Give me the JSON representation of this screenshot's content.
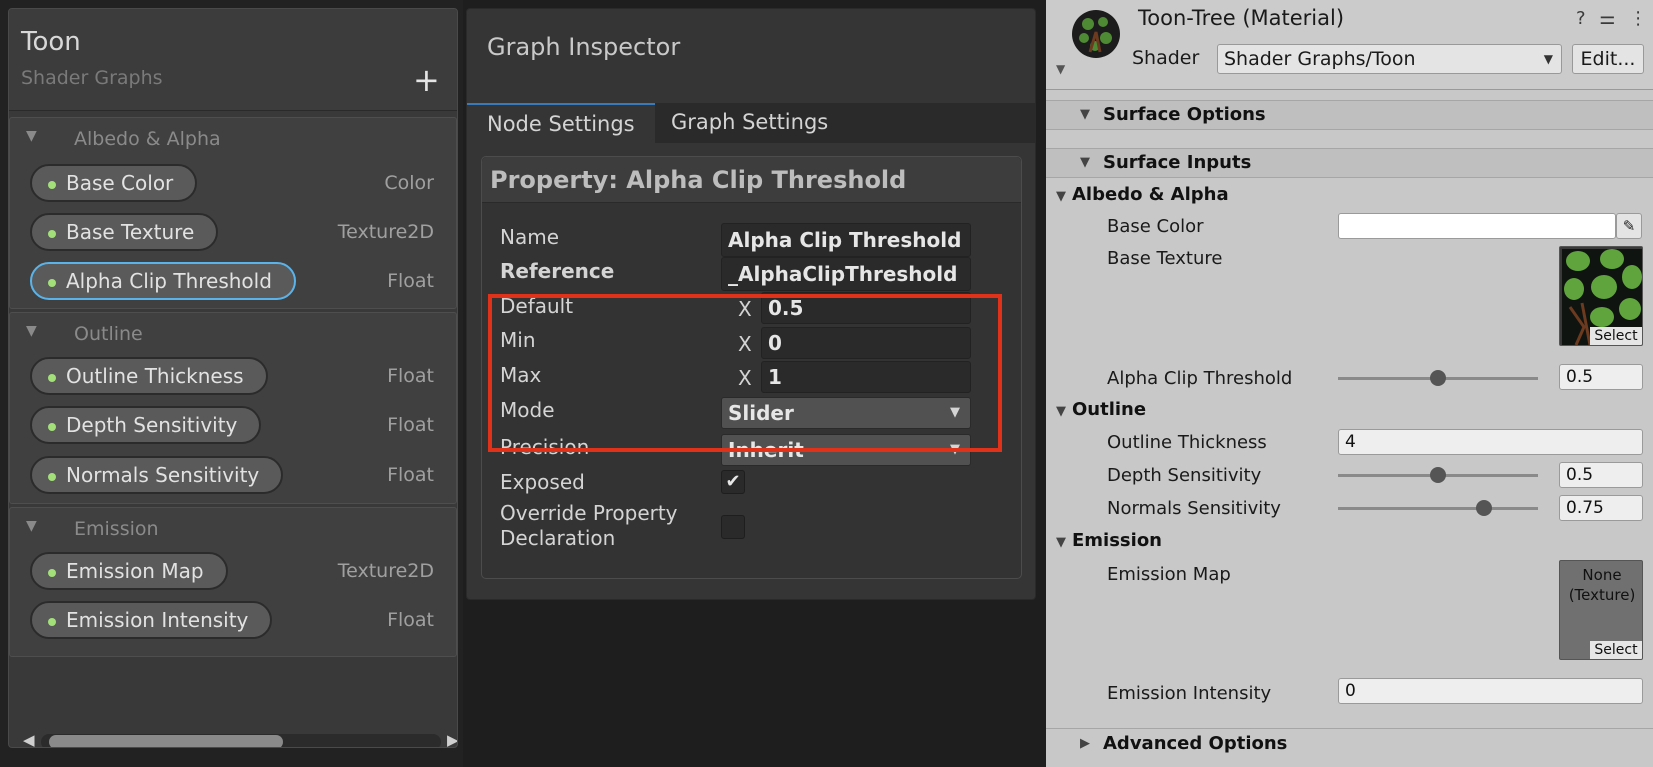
{
  "blackboard": {
    "title": "Toon",
    "subtitle": "Shader Graphs",
    "add_icon": "+",
    "categories": [
      {
        "name": "Albedo & Alpha",
        "properties": [
          {
            "label": "Base Color",
            "type": "Color"
          },
          {
            "label": "Base Texture",
            "type": "Texture2D"
          },
          {
            "label": "Alpha Clip Threshold",
            "type": "Float",
            "selected": true
          }
        ]
      },
      {
        "name": "Outline",
        "properties": [
          {
            "label": "Outline Thickness",
            "type": "Float"
          },
          {
            "label": "Depth Sensitivity",
            "type": "Float"
          },
          {
            "label": "Normals Sensitivity",
            "type": "Float"
          }
        ]
      },
      {
        "name": "Emission",
        "properties": [
          {
            "label": "Emission Map",
            "type": "Texture2D"
          },
          {
            "label": "Emission Intensity",
            "type": "Float"
          }
        ]
      }
    ],
    "scroll_left": "◀",
    "scroll_right": "▶"
  },
  "graph_inspector": {
    "title": "Graph Inspector",
    "tabs": [
      "Node Settings",
      "Graph Settings"
    ],
    "active_tab": "Node Settings",
    "property_title": "Property: Alpha Clip Threshold",
    "fields": {
      "name_label": "Name",
      "name_value": "Alpha Clip Threshold",
      "reference_label": "Reference",
      "reference_value": "_AlphaClipThreshold",
      "default_label": "Default",
      "default_value": "0.5",
      "min_label": "Min",
      "min_value": "0",
      "max_label": "Max",
      "max_value": "1",
      "axis_label": "X",
      "mode_label": "Mode",
      "mode_value": "Slider",
      "precision_label": "Precision",
      "precision_value": "Inherit",
      "exposed_label": "Exposed",
      "exposed_checked": true,
      "override_label_1": "Override Property",
      "override_label_2": "Declaration",
      "override_checked": false
    },
    "highlight_color": "#e0321a"
  },
  "material_inspector": {
    "name": "Toon-Tree (Material)",
    "header_icons": "? ⚌ ⋮",
    "shader_label": "Shader",
    "shader_value": "Shader Graphs/Toon",
    "edit_button": "Edit...",
    "section_surface_options": "Surface Options",
    "section_surface_inputs": "Surface Inputs",
    "section_advanced": "Advanced Options",
    "groups": {
      "albedo": "Albedo & Alpha",
      "outline": "Outline",
      "emission": "Emission"
    },
    "props": {
      "base_color_label": "Base Color",
      "base_texture_label": "Base Texture",
      "alpha_clip_label": "Alpha Clip Threshold",
      "alpha_clip_value": "0.5",
      "alpha_clip_slider": 0.5,
      "outline_thickness_label": "Outline Thickness",
      "outline_thickness_value": "4",
      "depth_label": "Depth Sensitivity",
      "depth_value": "0.5",
      "depth_slider": 0.5,
      "normals_label": "Normals Sensitivity",
      "normals_value": "0.75",
      "normals_slider": 0.75,
      "emission_map_label": "Emission Map",
      "emission_map_none_1": "None",
      "emission_map_none_2": "(Texture)",
      "emission_intensity_label": "Emission Intensity",
      "emission_intensity_value": "0",
      "select_label": "Select"
    },
    "base_color_swatch": "#ffffff"
  }
}
